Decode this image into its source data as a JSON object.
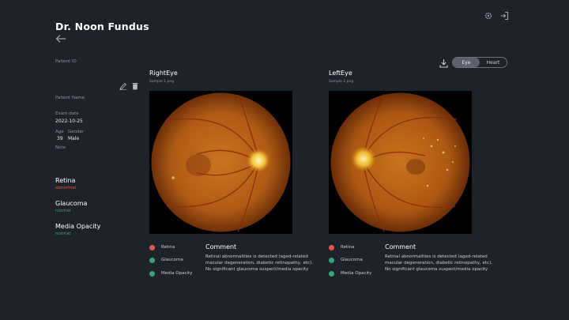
{
  "app": {
    "title": "Dr. Noon Fundus"
  },
  "patient": {
    "id_label": "Patient ID",
    "name_label": "Patient Name",
    "exam_date_label": "Exam date",
    "exam_date": "2022-10-25",
    "age_label": "Age",
    "age": "39",
    "gender_label": "Gender",
    "gender": "Male",
    "note_label": "Note"
  },
  "conditions": [
    {
      "name": "Retina",
      "status": "abnormal"
    },
    {
      "name": "Glaucoma",
      "status": "normal"
    },
    {
      "name": "Media Opacity",
      "status": "normal"
    }
  ],
  "toggle": {
    "eye": "Eye",
    "heart": "Heart",
    "selected": "Eye"
  },
  "eyes": [
    {
      "title": "RightEye",
      "file": "Sample 1.png"
    },
    {
      "title": "LeftEye",
      "file": "Sample 2.png"
    }
  ],
  "legend": {
    "retina": "Retina",
    "glaucoma": "Glaucoma",
    "media": "Media Opacity"
  },
  "comment": {
    "title": "Comment",
    "line1": "Retinal abnormalities is detected (aged-related",
    "line2": "macular degeneration, diabetic retinopathy, etc).",
    "line3": "No significant glaucoma suspect/media opacity"
  },
  "colors": {
    "background": "#1e222b",
    "abnormal": "#e0584c",
    "normal": "#38a37a"
  },
  "icons": [
    "back-arrow-icon",
    "settings-gear-icon",
    "logout-icon",
    "edit-pencil-icon",
    "trash-icon",
    "download-icon"
  ]
}
